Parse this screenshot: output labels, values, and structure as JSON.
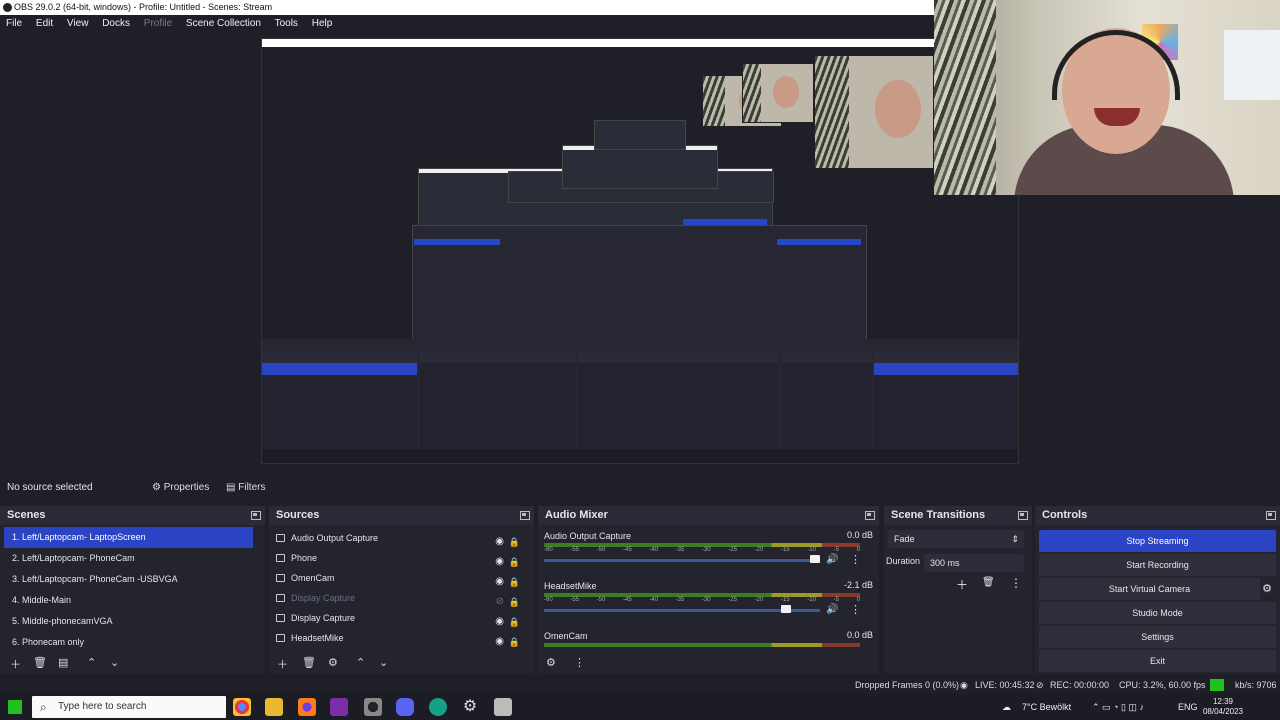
{
  "window": {
    "title": "OBS 29.0.2 (64-bit, windows) - Profile: Untitled - Scenes: Stream"
  },
  "menu": {
    "items": [
      "File",
      "Edit",
      "View",
      "Docks",
      "Profile",
      "Scene Collection",
      "Tools",
      "Help"
    ],
    "disabled": [
      "Profile"
    ]
  },
  "source_bar": {
    "no_source": "No source selected",
    "properties": "Properties",
    "filters": "Filters"
  },
  "scenes": {
    "title": "Scenes",
    "items": [
      "1. Left/Laptopcam- LaptopScreen",
      "2. Left/Laptopcam- PhoneCam",
      "3. Left/Laptopcam- PhoneCam -USBVGA",
      "4. Middle-Main",
      "5. Middle-phonecamVGA",
      "6. Phonecam only"
    ],
    "selected": 0
  },
  "sources": {
    "title": "Sources",
    "items": [
      {
        "name": "Audio Output Capture",
        "icon": "speaker-icon",
        "visible": true
      },
      {
        "name": "Phone",
        "icon": "phone-icon",
        "visible": true
      },
      {
        "name": "OmenCam",
        "icon": "camera-icon",
        "visible": true
      },
      {
        "name": "Display Capture",
        "icon": "monitor-icon",
        "visible": false
      },
      {
        "name": "Display Capture",
        "icon": "monitor-icon",
        "visible": true
      },
      {
        "name": "HeadsetMike",
        "icon": "microphone-icon",
        "visible": true
      }
    ]
  },
  "audio_mixer": {
    "title": "Audio Mixer",
    "scale": [
      "-60",
      "-55",
      "-50",
      "-45",
      "-40",
      "-35",
      "-30",
      "-25",
      "-20",
      "-15",
      "-10",
      "-5",
      "0"
    ],
    "channels": [
      {
        "name": "Audio Output Capture",
        "db": "0.0 dB",
        "level": 1.0
      },
      {
        "name": "HeadsetMike",
        "db": "-2.1 dB",
        "level": 0.89
      },
      {
        "name": "OmenCam",
        "db": "0.0 dB",
        "level": 1.0
      }
    ]
  },
  "transitions": {
    "title": "Scene Transitions",
    "type": "Fade",
    "duration_label": "Duration",
    "duration": "300 ms"
  },
  "controls": {
    "title": "Controls",
    "buttons": [
      "Stop Streaming",
      "Start Recording",
      "Start Virtual Camera",
      "Studio Mode",
      "Settings",
      "Exit"
    ]
  },
  "status": {
    "dropped": "Dropped Frames 0 (0.0%)",
    "live": "LIVE: 00:45:32",
    "rec": "REC: 00:00:00",
    "cpu": "CPU: 3.2%, 60.00 fps",
    "kbs": "kb/s: 9706"
  },
  "taskbar": {
    "search_placeholder": "Type here to search",
    "weather": "7°C  Bewölkt",
    "lang": "ENG",
    "time": "12:39",
    "date": "08/04/2023"
  },
  "colors": {
    "accent": "#2a44c4",
    "panel": "#23242e",
    "bg": "#1f1f28",
    "live": "#20c020"
  }
}
